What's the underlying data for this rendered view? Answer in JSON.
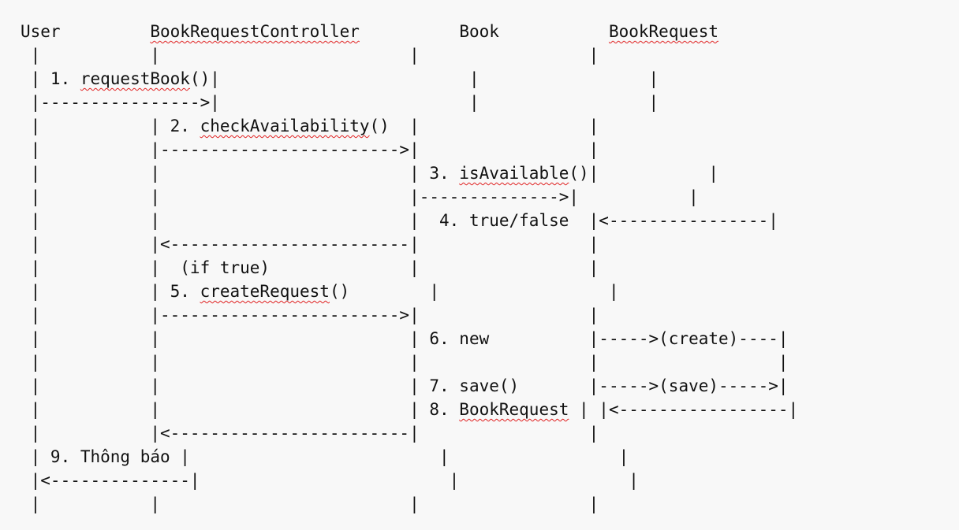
{
  "diagram": {
    "lines": [
      [
        {
          "t": "User         "
        },
        {
          "t": "BookRequestController",
          "sq": true
        },
        {
          "t": "          Book           "
        },
        {
          "t": "BookRequest",
          "sq": true
        }
      ],
      [
        {
          "t": " |           |                         |                 |"
        }
      ],
      [
        {
          "t": " | 1. "
        },
        {
          "t": "requestBook",
          "sq": true
        },
        {
          "t": "()|                         |                 |"
        }
      ],
      [
        {
          "t": " |---------------->|                         |                 |"
        }
      ],
      [
        {
          "t": " |           | 2. "
        },
        {
          "t": "checkAvailability",
          "sq": true
        },
        {
          "t": "()  |                 |"
        }
      ],
      [
        {
          "t": " |           |------------------------>|                 |"
        }
      ],
      [
        {
          "t": " |           |                         | 3. "
        },
        {
          "t": "isAvailable",
          "sq": true
        },
        {
          "t": "()|           |"
        }
      ],
      [
        {
          "t": " |           |                         |-------------->|           |"
        }
      ],
      [
        {
          "t": " |           |                         |  4. true/false  |<----------------|"
        }
      ],
      [
        {
          "t": " |           |<------------------------|                 |"
        }
      ],
      [
        {
          "t": " |           |  (if true)              |                 |"
        }
      ],
      [
        {
          "t": " |           | 5. "
        },
        {
          "t": "createRequest",
          "sq": true
        },
        {
          "t": "()        |                 |"
        }
      ],
      [
        {
          "t": " |           |------------------------>|                 |"
        }
      ],
      [
        {
          "t": " |           |                         | 6. new          |----->(create)----|"
        }
      ],
      [
        {
          "t": " |           |                         |                 |                  |"
        }
      ],
      [
        {
          "t": " |           |                         | 7. save()       |----->(save)----->|"
        }
      ],
      [
        {
          "t": " |           |                         | 8. "
        },
        {
          "t": "BookRequest",
          "sq": true
        },
        {
          "t": " | |<-----------------|"
        }
      ],
      [
        {
          "t": " |           |<------------------------|                 |"
        }
      ],
      [
        {
          "t": " | 9. Thông báo |                         |                 |"
        }
      ],
      [
        {
          "t": " |<--------------|                         |                 |"
        }
      ],
      [
        {
          "t": " |           |                         |                 |"
        }
      ]
    ]
  }
}
